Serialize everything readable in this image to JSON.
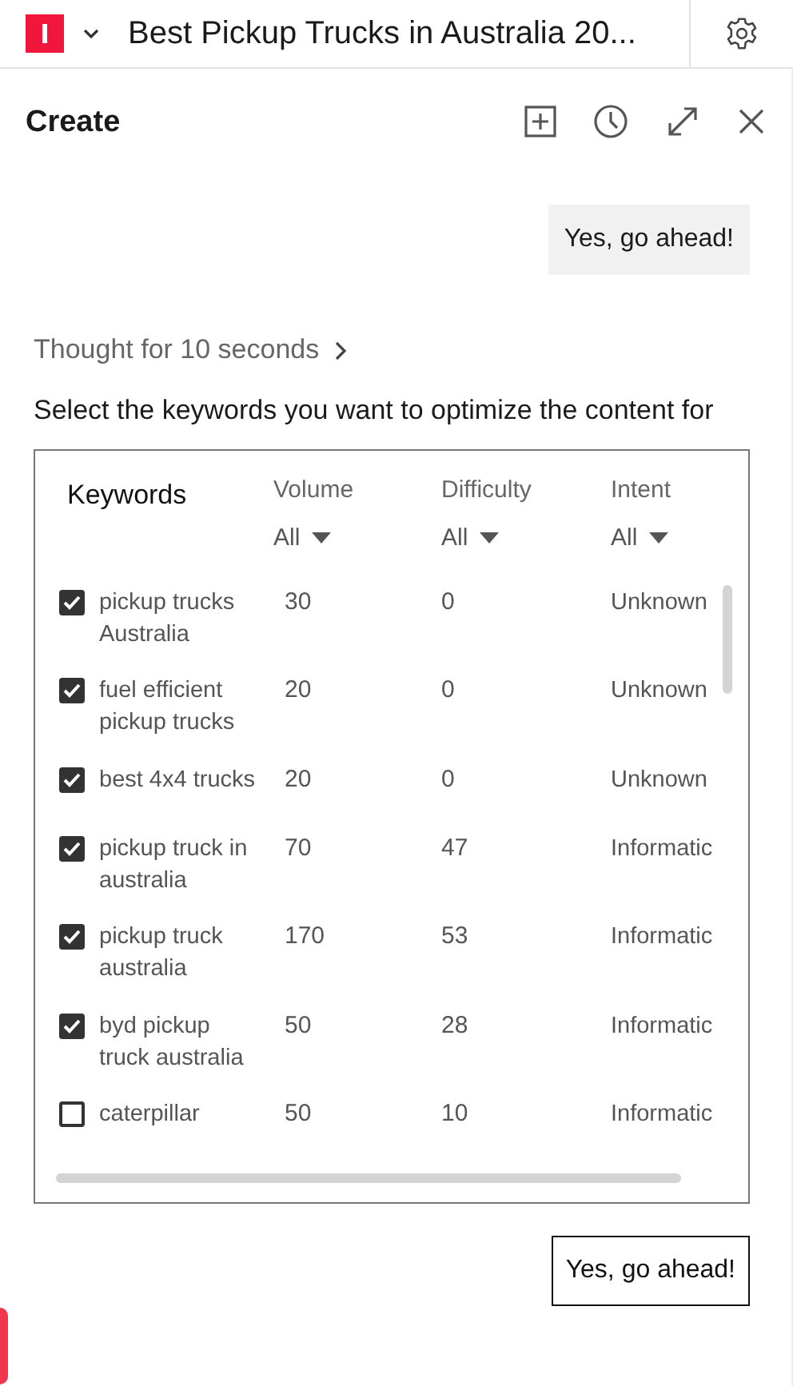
{
  "header": {
    "title": "Best Pickup Trucks in Australia 20..."
  },
  "panel": {
    "title": "Create"
  },
  "messages": [
    {
      "kind": "user",
      "text": "Yes, go ahead!"
    }
  ],
  "thought": {
    "label": "Thought for 10 seconds"
  },
  "prompt": "Select the keywords you want to optimize the content for",
  "table": {
    "columns": [
      {
        "label": "Keywords"
      },
      {
        "label": "Volume",
        "filter": "All"
      },
      {
        "label": "Difficulty",
        "filter": "All"
      },
      {
        "label": "Intent",
        "filter": "All"
      }
    ],
    "rows": [
      {
        "keyword": "pickup trucks Australia",
        "checked": true,
        "volume": "30",
        "difficulty": "0",
        "intent": "Unknown"
      },
      {
        "keyword": "fuel efficient pickup trucks",
        "checked": true,
        "volume": "20",
        "difficulty": "0",
        "intent": "Unknown"
      },
      {
        "keyword": "best 4x4 trucks",
        "checked": true,
        "volume": "20",
        "difficulty": "0",
        "intent": "Unknown"
      },
      {
        "keyword": "pickup truck in australia",
        "checked": true,
        "volume": "70",
        "difficulty": "47",
        "intent": "Informatic"
      },
      {
        "keyword": "pickup truck australia",
        "checked": true,
        "volume": "170",
        "difficulty": "53",
        "intent": "Informatic"
      },
      {
        "keyword": "byd pickup truck australia",
        "checked": true,
        "volume": "50",
        "difficulty": "28",
        "intent": "Informatic"
      },
      {
        "keyword": "caterpillar",
        "checked": false,
        "volume": "50",
        "difficulty": "10",
        "intent": "Informatic"
      }
    ]
  },
  "reply_button": "Yes, go ahead!"
}
